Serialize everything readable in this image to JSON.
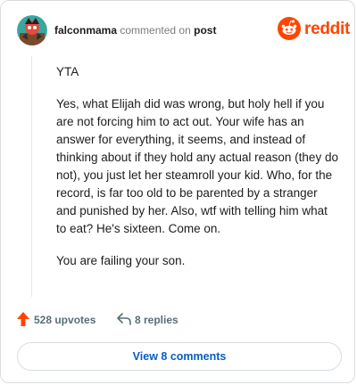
{
  "comment": {
    "username": "falconmama",
    "action_text": "commented on",
    "post_link": "post",
    "brand": "reddit",
    "paragraphs": [
      "YTA",
      "Yes, what Elijah did was wrong, but holy hell if you are not forcing him to act out. Your wife has an answer for everything, it seems, and instead of thinking about if they hold any actual reason (they do not), you just let her steamroll your kid. Who, for the record, is far too old to be parented by a stranger and punished by her. Also, wtf with telling him what to eat? He's sixteen. Come on.",
      "You are failing your son."
    ]
  },
  "actions": {
    "upvotes": "528 upvotes",
    "replies": "8 replies"
  },
  "view_button": "View 8 comments",
  "icons": {
    "avatar": "user-avatar",
    "logo": "reddit-snoo-icon",
    "upvote": "upvote-arrow-icon",
    "reply": "reply-arrow-icon"
  },
  "colors": {
    "brand": "#ff4500",
    "link": "#0a5dbf",
    "muted": "#576f76"
  }
}
